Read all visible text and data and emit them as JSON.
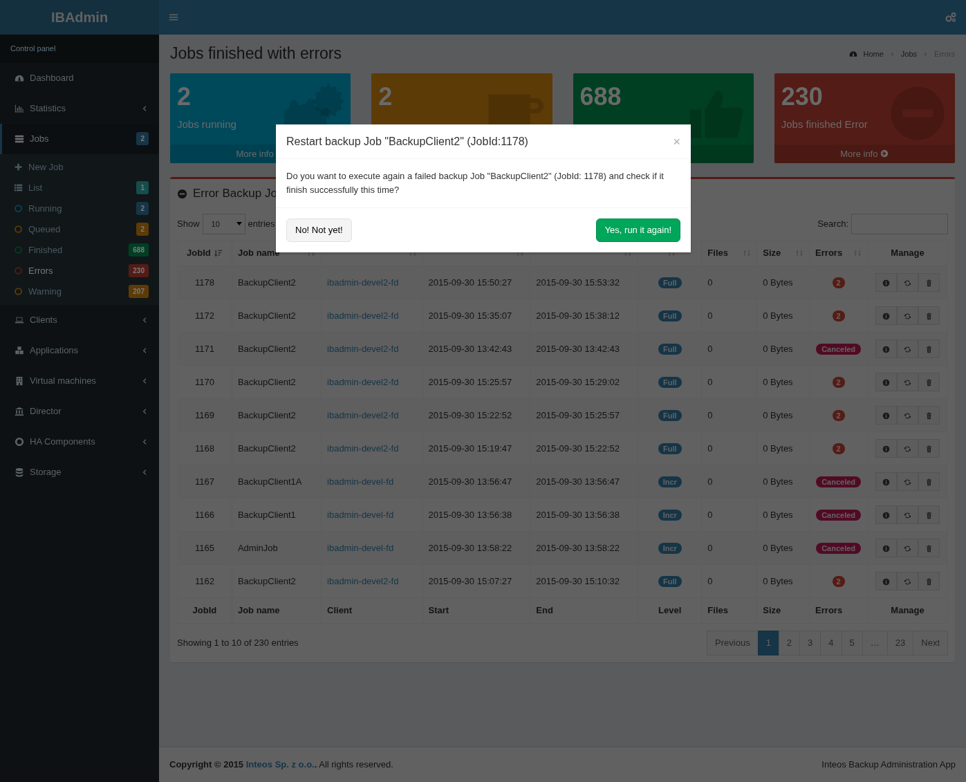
{
  "app": {
    "logo": "IBAdmin"
  },
  "sidebar": {
    "header": "Control panel",
    "items": [
      {
        "label": "Dashboard",
        "selected": false,
        "expandable": false
      },
      {
        "label": "Statistics",
        "selected": false,
        "expandable": true
      },
      {
        "label": "Jobs",
        "selected": true,
        "expanded": true,
        "badge": {
          "text": "2",
          "color": "#173547"
        },
        "children": [
          {
            "label": "New Job",
            "selected": false
          },
          {
            "label": "List",
            "selected": false,
            "badge": {
              "text": "1",
              "color": "#164d4d"
            }
          },
          {
            "label": "Running",
            "color": "#00495b",
            "selected": false,
            "badge": {
              "text": "2",
              "color": "#173547"
            }
          },
          {
            "label": "Queued",
            "color": "#5c3b07",
            "selected": false,
            "badge": {
              "text": "2",
              "color": "#5c3b07"
            }
          },
          {
            "label": "Finished",
            "color": "#003f22",
            "selected": false,
            "badge": {
              "text": "688",
              "color": "#003f22"
            }
          },
          {
            "label": "Errors",
            "color": "#541c16",
            "selected": true,
            "badge": {
              "text": "230",
              "color": "#541c16"
            }
          },
          {
            "label": "Warning",
            "color": "#5c3b07",
            "selected": false,
            "badge": {
              "text": "207",
              "color": "#5c3b07"
            }
          }
        ]
      },
      {
        "label": "Clients",
        "selected": false,
        "expandable": true
      },
      {
        "label": "Applications",
        "selected": false,
        "expandable": true
      },
      {
        "label": "Virtual machines",
        "selected": false,
        "expandable": true
      },
      {
        "label": "Director",
        "selected": false,
        "expandable": true
      },
      {
        "label": "HA Components",
        "selected": false,
        "expandable": true
      },
      {
        "label": "Storage",
        "selected": false,
        "expandable": true
      }
    ]
  },
  "page": {
    "title": "Jobs finished with errors",
    "breadcrumb": [
      "Home",
      "Jobs",
      "Errors"
    ]
  },
  "stat_cards": [
    {
      "number": "2",
      "label": "Jobs running",
      "color": "#00495b",
      "more_info": "More info"
    },
    {
      "number": "2",
      "color": "#5c3b07"
    },
    {
      "number": "688",
      "color": "#003f22"
    },
    {
      "number": "230",
      "label": "Jobs finished Error",
      "color": "#541c16",
      "more_info": "More info"
    }
  ],
  "box": {
    "title": "Error Backup Jo",
    "show_label": "Show",
    "page_size": "10",
    "entries_label": "entries",
    "search_label": "Search:",
    "columns": [
      {
        "label": "JobId",
        "sortable": true,
        "sorted": true
      },
      {
        "label": "Job name",
        "sortable": true,
        "sorted": false
      },
      {
        "sortable": true,
        "sorted": false
      },
      {
        "sortable": true,
        "sorted": false
      },
      {
        "sortable": true,
        "sorted": false
      },
      {
        "sortable": true,
        "sorted": false
      },
      {
        "label": "Files",
        "sortable": true,
        "sorted": false
      },
      {
        "label": "Size",
        "sortable": true,
        "sorted": false
      },
      {
        "label": "Errors",
        "sortable": true,
        "sorted": false
      },
      {
        "label": "Manage",
        "sortable": false
      }
    ],
    "rows": [
      {
        "jobid": "1178",
        "name": "BackupClient2",
        "client": "ibadmin-devel2-fd",
        "start": "2015-09-30 15:50:27",
        "end": "2015-09-30 15:53:32",
        "level": "Full",
        "files": "0",
        "size": "0 Bytes",
        "errors": {
          "kind": "count",
          "text": "2"
        }
      },
      {
        "jobid": "1172",
        "name": "BackupClient2",
        "client": "ibadmin-devel2-fd",
        "start": "2015-09-30 15:35:07",
        "end": "2015-09-30 15:38:12",
        "level": "Full",
        "files": "0",
        "size": "0 Bytes",
        "errors": {
          "kind": "count",
          "text": "2"
        }
      },
      {
        "jobid": "1171",
        "name": "BackupClient2",
        "client": "ibadmin-devel2-fd",
        "start": "2015-09-30 13:42:43",
        "end": "2015-09-30 13:42:43",
        "level": "Full",
        "files": "0",
        "size": "0 Bytes",
        "errors": {
          "kind": "canceled",
          "text": "Canceled"
        }
      },
      {
        "jobid": "1170",
        "name": "BackupClient2",
        "client": "ibadmin-devel2-fd",
        "start": "2015-09-30 15:25:57",
        "end": "2015-09-30 15:29:02",
        "level": "Full",
        "files": "0",
        "size": "0 Bytes",
        "errors": {
          "kind": "count",
          "text": "2"
        }
      },
      {
        "jobid": "1169",
        "name": "BackupClient2",
        "client": "ibadmin-devel2-fd",
        "start": "2015-09-30 15:22:52",
        "end": "2015-09-30 15:25:57",
        "level": "Full",
        "files": "0",
        "size": "0 Bytes",
        "errors": {
          "kind": "count",
          "text": "2"
        }
      },
      {
        "jobid": "1168",
        "name": "BackupClient2",
        "client": "ibadmin-devel2-fd",
        "start": "2015-09-30 15:19:47",
        "end": "2015-09-30 15:22:52",
        "level": "Full",
        "files": "0",
        "size": "0 Bytes",
        "errors": {
          "kind": "count",
          "text": "2"
        }
      },
      {
        "jobid": "1167",
        "name": "BackupClient1A",
        "client": "ibadmin-devel-fd",
        "start": "2015-09-30 13:56:47",
        "end": "2015-09-30 13:56:47",
        "level": "Incr",
        "files": "0",
        "size": "0 Bytes",
        "errors": {
          "kind": "canceled",
          "text": "Canceled"
        }
      },
      {
        "jobid": "1166",
        "name": "BackupClient1",
        "client": "ibadmin-devel-fd",
        "start": "2015-09-30 13:56:38",
        "end": "2015-09-30 13:56:38",
        "level": "Incr",
        "files": "0",
        "size": "0 Bytes",
        "errors": {
          "kind": "canceled",
          "text": "Canceled"
        }
      },
      {
        "jobid": "1165",
        "name": "AdminJob",
        "client": "ibadmin-devel-fd",
        "start": "2015-09-30 13:58:22",
        "end": "2015-09-30 13:58:22",
        "level": "Incr",
        "files": "0",
        "size": "0 Bytes",
        "errors": {
          "kind": "canceled",
          "text": "Canceled"
        }
      },
      {
        "jobid": "1162",
        "name": "BackupClient2",
        "client": "ibadmin-devel2-fd",
        "start": "2015-09-30 15:07:27",
        "end": "2015-09-30 15:10:32",
        "level": "Full",
        "files": "0",
        "size": "0 Bytes",
        "errors": {
          "kind": "count",
          "text": "2"
        }
      }
    ],
    "footer_columns": [
      "JobId",
      "Job name",
      "Client",
      "Start",
      "End",
      "Level",
      "Files",
      "Size",
      "Errors",
      "Manage"
    ],
    "info": "Showing 1 to 10 of 230 entries",
    "pagination": [
      {
        "label": "Previous",
        "selected": false
      },
      {
        "label": "1",
        "selected": true
      },
      {
        "label": "2",
        "selected": false
      },
      {
        "label": "3",
        "selected": false
      },
      {
        "label": "4",
        "selected": false
      },
      {
        "label": "5",
        "selected": false
      },
      {
        "label": "…",
        "selected": false
      },
      {
        "label": "23",
        "selected": false
      },
      {
        "label": "Next",
        "selected": false
      }
    ]
  },
  "footer": {
    "copyright": "**Copyright © 2015**",
    "company": "Inteos Sp. z o.o.",
    "rights": "**.** All rights reserved.",
    "app_name": "Inteos Backup Administration App"
  },
  "modal": {
    "title": "Restart backup Job \"BackupClient2\" (JobId:1178)",
    "close": "×",
    "body": "Do you want to execute again a failed backup Job \"BackupClient2\" (JobId: 1178) and check if it finish successfully this time?",
    "cancel": "No! Not yet!",
    "confirm": "Yes, run it again!"
  }
}
